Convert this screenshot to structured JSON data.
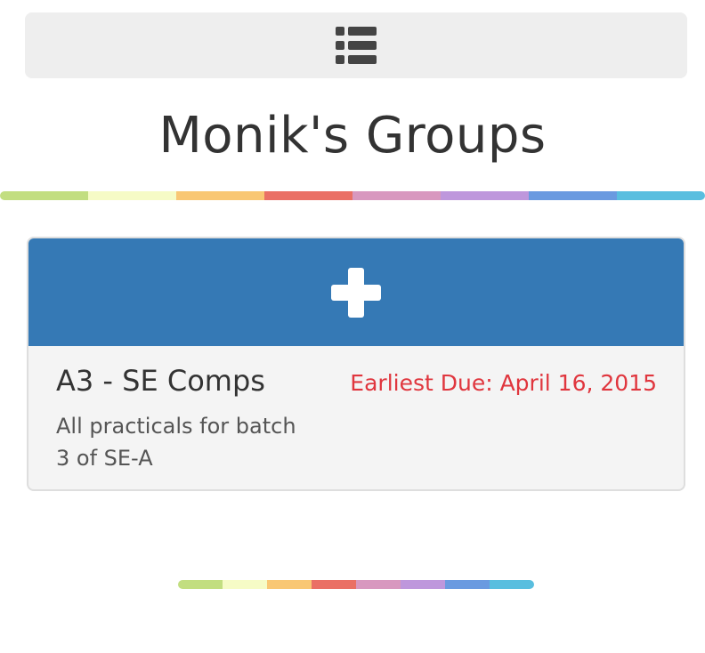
{
  "header": {
    "menu_icon": "list-icon",
    "title": "Monik's Groups"
  },
  "stripe_colors": [
    "#c2de80",
    "#f6fbc6",
    "#f9c774",
    "#ea7065",
    "#d898bf",
    "#be97dc",
    "#6a9ae0",
    "#59bedf"
  ],
  "add_group": {
    "icon": "plus-icon",
    "color": "#3579b5"
  },
  "groups": [
    {
      "name": "A3 - SE Comps",
      "due": "Earliest Due: April 16, 2015",
      "description": "All practicals for batch 3 of SE-A"
    }
  ],
  "accent_colors": {
    "due": "#e0363e",
    "text": "#333333"
  }
}
